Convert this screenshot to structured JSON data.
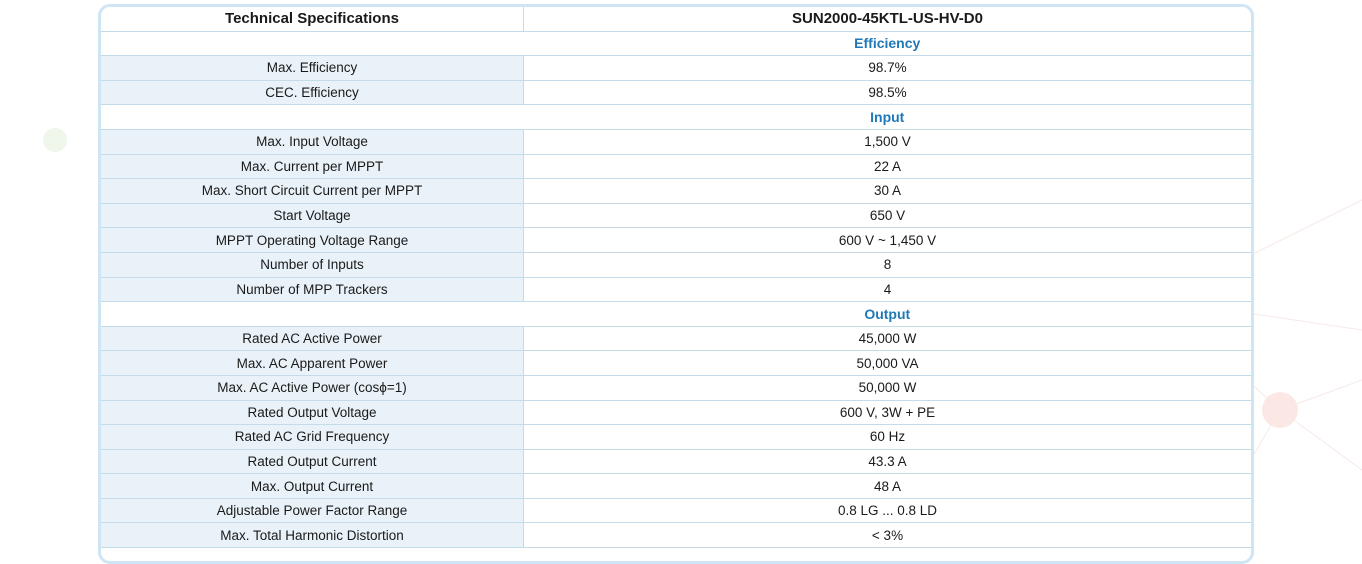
{
  "header": {
    "label": "Technical Specifications",
    "model": "SUN2000-45KTL-US-HV-D0"
  },
  "sections": [
    {
      "title": "Efficiency",
      "rows": [
        {
          "label": "Max. Efficiency",
          "value": "98.7%"
        },
        {
          "label": "CEC. Efficiency",
          "value": "98.5%"
        }
      ]
    },
    {
      "title": "Input",
      "rows": [
        {
          "label": "Max. Input Voltage",
          "value": "1,500 V"
        },
        {
          "label": "Max. Current per MPPT",
          "value": "22 A"
        },
        {
          "label": "Max. Short Circuit Current per MPPT",
          "value": "30 A"
        },
        {
          "label": "Start Voltage",
          "value": "650 V"
        },
        {
          "label": "MPPT Operating Voltage Range",
          "value": "600 V ~ 1,450 V"
        },
        {
          "label": "Number of Inputs",
          "value": "8"
        },
        {
          "label": "Number of MPP Trackers",
          "value": "4"
        }
      ]
    },
    {
      "title": "Output",
      "rows": [
        {
          "label": "Rated AC Active Power",
          "value": "45,000 W"
        },
        {
          "label": "Max. AC Apparent Power",
          "value": "50,000 VA"
        },
        {
          "label": "Max. AC Active Power (cosϕ=1)",
          "value": "50,000 W"
        },
        {
          "label": "Rated Output Voltage",
          "value": "600 V, 3W + PE"
        },
        {
          "label": "Rated AC Grid Frequency",
          "value": "60 Hz"
        },
        {
          "label": "Rated Output Current",
          "value": "43.3 A"
        },
        {
          "label": "Max. Output Current",
          "value": "48 A"
        },
        {
          "label": "Adjustable Power Factor Range",
          "value": "0.8 LG ... 0.8 LD"
        },
        {
          "label": "Max. Total Harmonic Distortion",
          "value": "< 3%"
        }
      ]
    }
  ]
}
